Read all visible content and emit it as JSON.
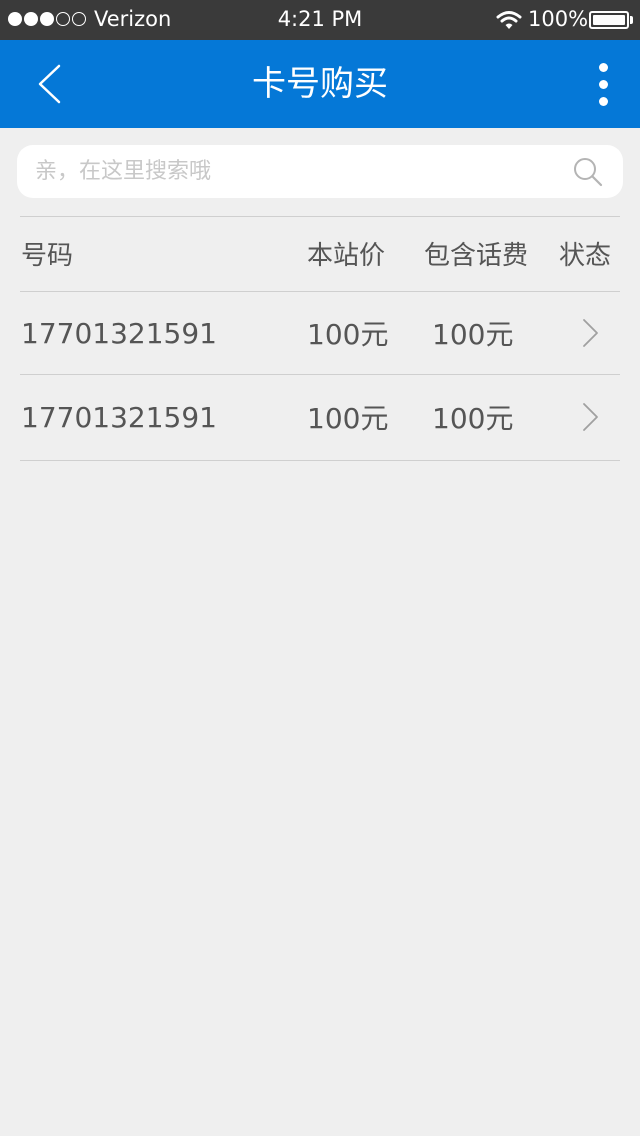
{
  "status_bar": {
    "carrier": "Verizon",
    "time": "4:21 PM",
    "battery": "100%",
    "signal_filled": 3,
    "signal_total": 5
  },
  "nav": {
    "title": "卡号购买",
    "back_icon": "chevron-left-icon",
    "more_icon": "more-vertical-icon"
  },
  "search": {
    "placeholder": "亲，在这里搜索哦",
    "value": "",
    "icon": "search-icon"
  },
  "table": {
    "headers": {
      "number": "号码",
      "price": "本站价",
      "fee": "包含话费",
      "status": "状态"
    },
    "rows": [
      {
        "number": "17701321591",
        "price": "100元",
        "fee": "100元"
      },
      {
        "number": "17701321591",
        "price": "100元",
        "fee": "100元"
      }
    ]
  },
  "colors": {
    "accent": "#0578d7",
    "status_bar": "#3a3a3a",
    "background": "#efefef",
    "text": "#555555",
    "placeholder": "#c8c8c8",
    "divider": "#cfcfcf"
  }
}
